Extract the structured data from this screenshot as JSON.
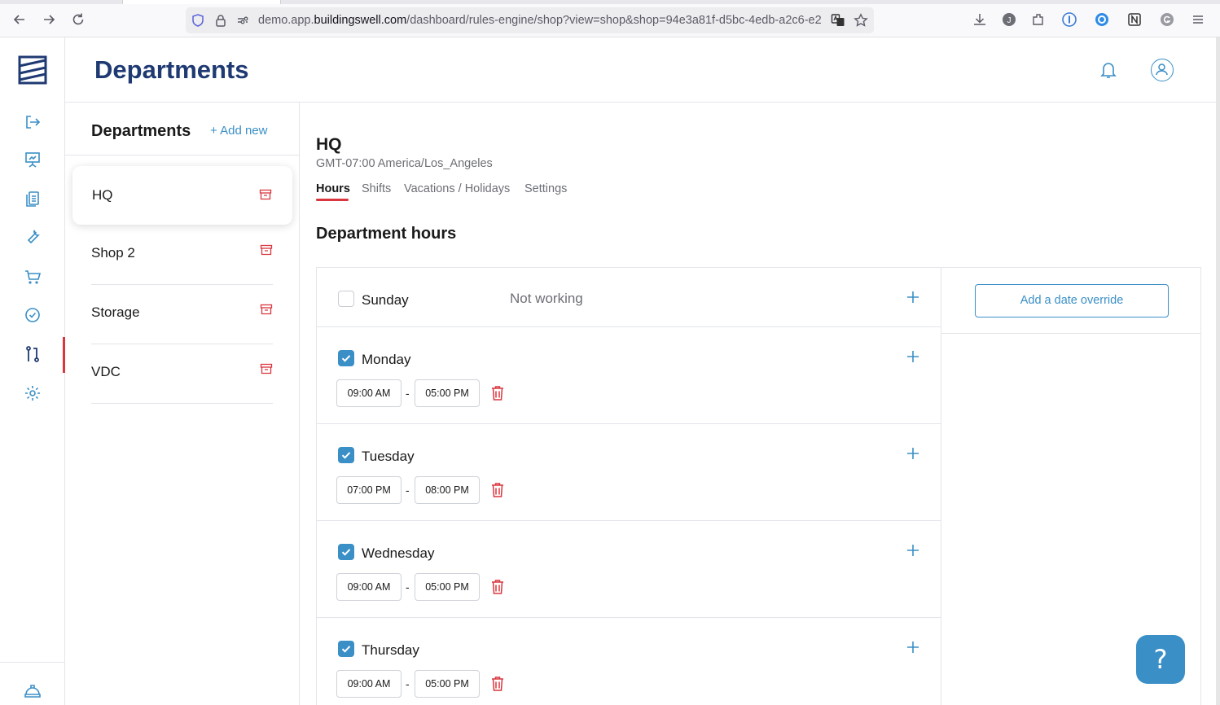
{
  "browser": {
    "url_prefix": "demo.app.",
    "url_host": "buildingswell.com",
    "url_path": "/dashboard/rules-engine/shop?view=shop&shop=94e3a81f-d5bc-4edb-a2c6-e2"
  },
  "header": {
    "title": "Departments"
  },
  "departments_panel": {
    "title": "Departments",
    "add_new_label": "Add new",
    "items": [
      {
        "label": "HQ",
        "selected": true
      },
      {
        "label": "Shop 2",
        "selected": false
      },
      {
        "label": "Storage",
        "selected": false
      },
      {
        "label": "VDC",
        "selected": false
      }
    ]
  },
  "shop": {
    "name": "HQ",
    "timezone": "GMT-07:00 America/Los_Angeles",
    "tabs": [
      {
        "label": "Hours",
        "active": true
      },
      {
        "label": "Shifts",
        "active": false
      },
      {
        "label": "Vacations / Holidays",
        "active": false
      },
      {
        "label": "Settings",
        "active": false
      }
    ]
  },
  "hours": {
    "section_title": "Department hours",
    "not_working_label": "Not working",
    "override_button_label": "Add a date override",
    "days": [
      {
        "name": "Sunday",
        "checked": false,
        "ranges": []
      },
      {
        "name": "Monday",
        "checked": true,
        "ranges": [
          {
            "start": "09:00 AM",
            "end": "05:00 PM"
          }
        ]
      },
      {
        "name": "Tuesday",
        "checked": true,
        "ranges": [
          {
            "start": "07:00 PM",
            "end": "08:00 PM"
          }
        ]
      },
      {
        "name": "Wednesday",
        "checked": true,
        "ranges": [
          {
            "start": "09:00 AM",
            "end": "05:00 PM"
          }
        ]
      },
      {
        "name": "Thursday",
        "checked": true,
        "ranges": [
          {
            "start": "09:00 AM",
            "end": "05:00 PM"
          }
        ]
      }
    ],
    "range_separator": "-"
  },
  "help": {
    "label": "?"
  },
  "colors": {
    "accent": "#3a8fc6",
    "title": "#1f3a73",
    "danger": "#d9363e"
  }
}
